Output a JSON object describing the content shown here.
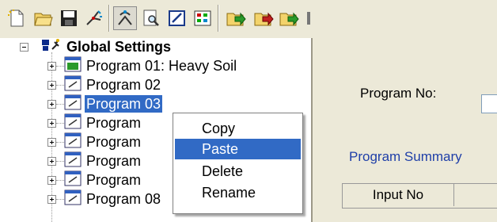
{
  "toolbar": {
    "buttons": [
      {
        "icon": "new-file-icon",
        "pressed": false
      },
      {
        "icon": "open-folder-icon",
        "pressed": false
      },
      {
        "icon": "save-icon",
        "pressed": false
      },
      {
        "icon": "sprinkler-icon",
        "pressed": false
      },
      {
        "icon": "irrigation-tool-icon",
        "pressed": true
      },
      {
        "icon": "print-preview-icon",
        "pressed": false
      },
      {
        "icon": "edit-icon",
        "pressed": false
      },
      {
        "icon": "grid-view-icon",
        "pressed": false
      },
      {
        "icon": "run-program-icon",
        "pressed": false
      },
      {
        "icon": "stop-program-icon",
        "pressed": false
      },
      {
        "icon": "next-program-icon",
        "pressed": false
      },
      {
        "icon": "more-icon",
        "pressed": false
      }
    ]
  },
  "tree": {
    "root": "Global Settings",
    "items": [
      {
        "label": "Program 01: Heavy Soil",
        "selected": false
      },
      {
        "label": "Program 02",
        "selected": false
      },
      {
        "label": "Program 03",
        "selected": true
      },
      {
        "label": "Program",
        "selected": false
      },
      {
        "label": "Program",
        "selected": false
      },
      {
        "label": "Program",
        "selected": false
      },
      {
        "label": "Program",
        "selected": false
      },
      {
        "label": "Program 08",
        "selected": false
      }
    ]
  },
  "context_menu": {
    "items": [
      {
        "label": "Copy",
        "highlighted": false
      },
      {
        "label": "Paste",
        "highlighted": true
      },
      {
        "label": "Delete",
        "highlighted": false
      },
      {
        "label": "Rename",
        "highlighted": false
      }
    ]
  },
  "details": {
    "program_no_label": "Program No:",
    "program_summary_label": "Program Summary",
    "input_no_header": "Input No"
  },
  "colors": {
    "selection": "#316ac5",
    "link_blue": "#1f3fa8"
  }
}
